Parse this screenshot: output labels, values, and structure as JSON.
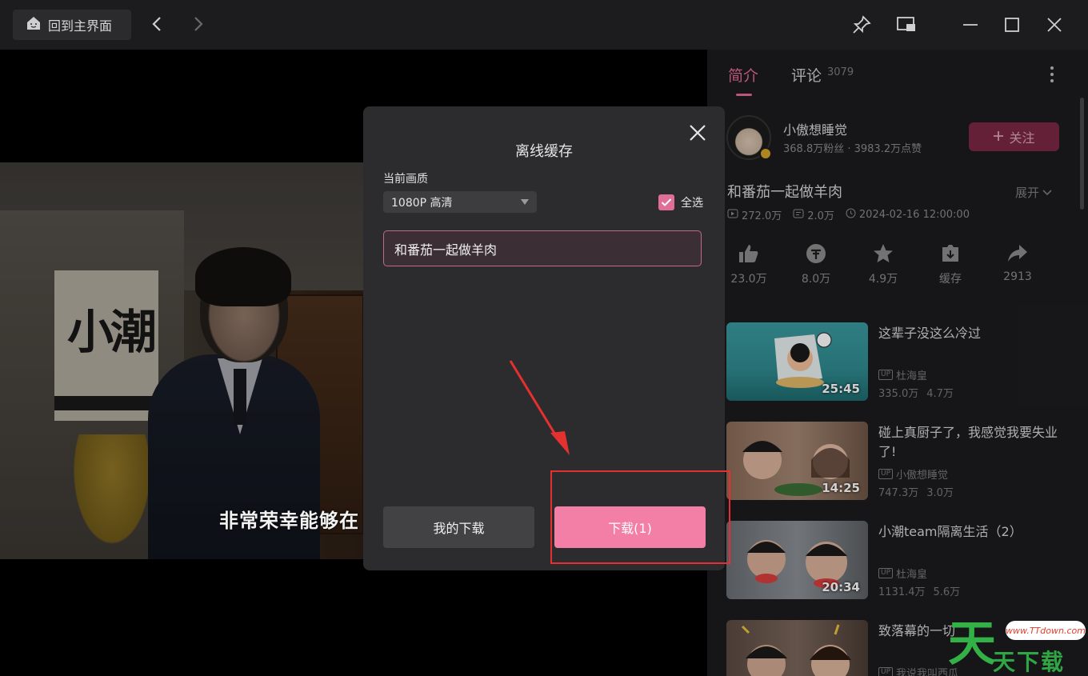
{
  "topbar": {
    "home_label": "回到主界面"
  },
  "video": {
    "poster_text": "小潮",
    "subtitle": "非常荣幸能够在"
  },
  "right_panel": {
    "tabs": {
      "intro": "简介",
      "comments": "评论",
      "comment_count": "3079"
    },
    "uploader": {
      "name": "小傲想睡觉",
      "stats": "368.8万粉丝 · 3983.2万点赞",
      "follow_label": "关注"
    },
    "title": "和番茄一起做羊肉",
    "expand_label": "展开",
    "meta": {
      "views": "272.0万",
      "danmaku": "2.0万",
      "date": "2024-02-16 12:00:00"
    },
    "actions": [
      {
        "icon": "thumbs-up-icon",
        "label": "23.0万"
      },
      {
        "icon": "coin-icon",
        "label": "8.0万"
      },
      {
        "icon": "star-icon",
        "label": "4.9万"
      },
      {
        "icon": "cache-icon",
        "label": "缓存"
      },
      {
        "icon": "share-icon",
        "label": "2913"
      }
    ],
    "recommendations": [
      {
        "title": "这辈子没这么冷过",
        "duration": "25:45",
        "author": "杜海皇",
        "views": "335.0万",
        "danmaku": "4.7万"
      },
      {
        "title": "碰上真厨子了，我感觉我要失业了!",
        "duration": "14:25",
        "author": "小傲想睡觉",
        "views": "747.3万",
        "danmaku": "3.0万"
      },
      {
        "title": "小潮team隔离生活（2）",
        "duration": "20:34",
        "author": "杜海皇",
        "views": "1131.4万",
        "danmaku": "5.6万"
      },
      {
        "title": "致落幕的一切",
        "duration": "",
        "author": "我说我叫西瓜",
        "views": "",
        "danmaku": ""
      }
    ]
  },
  "modal": {
    "title": "离线缓存",
    "quality_label": "当前画质",
    "quality_value": "1080P 高清",
    "select_all_label": "全选",
    "episode": "和番茄一起做羊肉",
    "my_downloads_label": "我的下载",
    "download_label": "下载(1)"
  },
  "watermark": {
    "big": "天",
    "url": "www.TTdown.com",
    "text": "天下载"
  },
  "colors": {
    "accent": "#e36b91",
    "download_button": "#f47fa6",
    "annotation": "#e53030"
  }
}
